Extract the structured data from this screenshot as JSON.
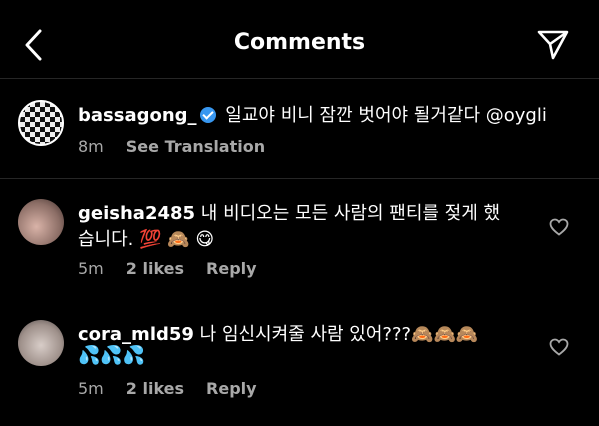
{
  "header": {
    "title": "Comments"
  },
  "caption": {
    "username": "bassagong_",
    "text": "일교야 비니 잠깐 벗어야 될거같다 @oygli",
    "time": "8m",
    "see_translation": "See Translation"
  },
  "comments": [
    {
      "username": "geisha2485",
      "text_line1": "내 비디오는 모든 사람의 팬티를 젖게 했",
      "text_line2": "습니다.",
      "emojis": "💯 🙈 😋",
      "time": "5m",
      "likes": "2 likes",
      "reply": "Reply"
    },
    {
      "username": "cora_mld59",
      "text_line1": "나 임신시켜줄 사람 있어???",
      "emojis_line1": "🙈🙈🙈",
      "emojis_line2": "💦💦💦",
      "time": "5m",
      "likes": "2 likes",
      "reply": "Reply"
    }
  ],
  "colors": {
    "background": "#000000",
    "secondary_text": "#a8a8a8",
    "divider": "#262626",
    "verified": "#3897f0"
  }
}
